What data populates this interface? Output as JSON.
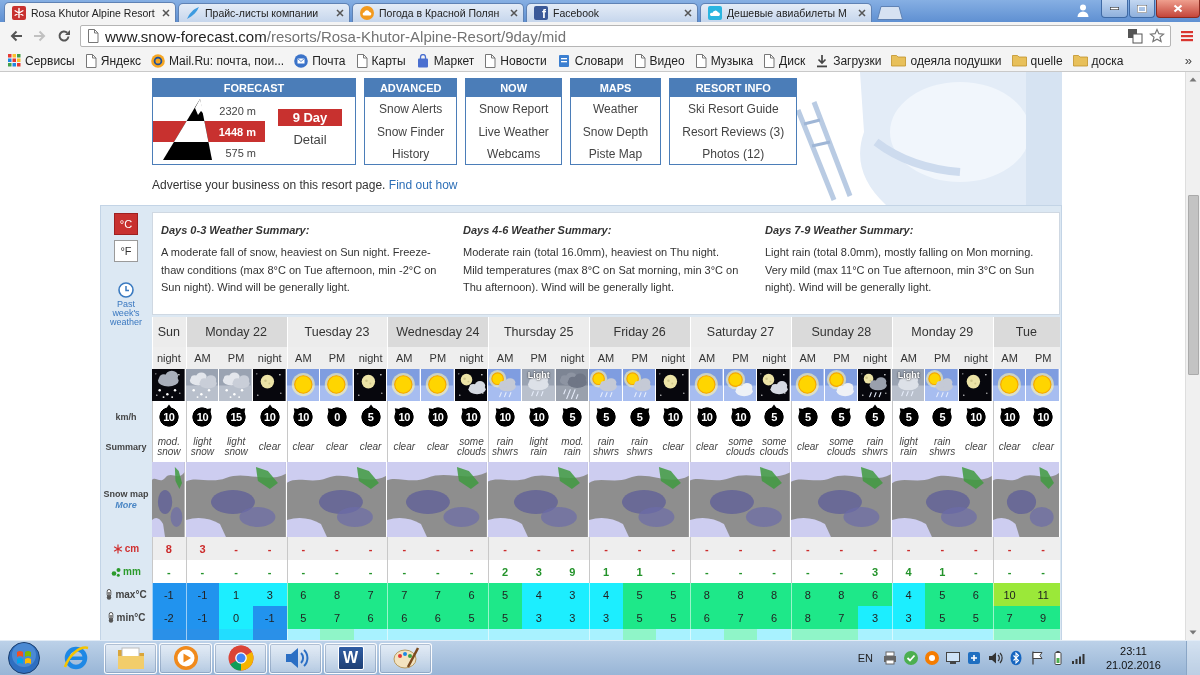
{
  "browser": {
    "tabs": [
      {
        "title": "Rosa Khutor Alpine Resort",
        "selected": true
      },
      {
        "title": "Прайс-листы компании",
        "selected": false
      },
      {
        "title": "Погода в Красной Полян",
        "selected": false
      },
      {
        "title": "Facebook",
        "icon_text": "f",
        "selected": false
      },
      {
        "title": "Дешевые авиабилеты М",
        "selected": false
      }
    ],
    "address": {
      "host": "www.snow-forecast.com",
      "path": "/resorts/Rosa-Khutor-Alpine-Resort/9day/mid"
    },
    "bookmarks": [
      {
        "label": "Сервисы"
      },
      {
        "label": "Яндекс"
      },
      {
        "label": "Mail.Ru: почта, пои..."
      },
      {
        "label": "Почта"
      },
      {
        "label": "Карты"
      },
      {
        "label": "Маркет"
      },
      {
        "label": "Новости"
      },
      {
        "label": "Словари"
      },
      {
        "label": "Видео"
      },
      {
        "label": "Музыка"
      },
      {
        "label": "Диск"
      },
      {
        "label": "Загрузки"
      },
      {
        "label": "одеяла подушки"
      },
      {
        "label": "quelle"
      },
      {
        "label": "доска"
      }
    ],
    "bookmarks_more": "»"
  },
  "site": {
    "nav": [
      {
        "kind": "forecast",
        "heading": "FORECAST",
        "elevations": [
          {
            "label": "2320 m",
            "selected": false
          },
          {
            "label": "1448 m",
            "selected": true
          },
          {
            "label": "575 m",
            "selected": false
          }
        ],
        "views": [
          {
            "label": "9 Day",
            "selected": true
          },
          {
            "label": "Detail",
            "selected": false
          }
        ]
      },
      {
        "kind": "links",
        "heading": "ADVANCED",
        "links": [
          "Snow Alerts",
          "Snow Finder",
          "History"
        ]
      },
      {
        "kind": "links",
        "heading": "NOW",
        "links": [
          "Snow Report",
          "Live Weather",
          "Webcams"
        ]
      },
      {
        "kind": "links",
        "heading": "MAPS",
        "links": [
          "Weather",
          "Snow Depth",
          "Piste Map"
        ]
      },
      {
        "kind": "links",
        "heading": "RESORT INFO",
        "links": [
          "Ski Resort Guide",
          "Resort Reviews (3)",
          "Photos (12)"
        ]
      }
    ],
    "advert": {
      "text": "Advertise your business on this resort page.",
      "link": "Find out how"
    }
  },
  "forecast": {
    "units": [
      {
        "label": "°C",
        "selected": true
      },
      {
        "label": "°F",
        "selected": false
      }
    ],
    "past_weather": "Past week's weather",
    "summaries": [
      {
        "title": "Days 0-3 Weather Summary:",
        "text": "A moderate fall of snow, heaviest on Sun night. Freeze-thaw conditions (max 8°C on Tue afternoon, min -2°C on Sun night). Wind will be generally light."
      },
      {
        "title": "Days 4-6 Weather Summary:",
        "text": "Moderate rain (total 16.0mm), heaviest on Thu night. Mild temperatures (max 8°C on Sat morning, min 3°C on Thu afternoon). Wind will be generally light."
      },
      {
        "title": "Days 7-9 Weather Summary:",
        "text": "Light rain (total 8.0mm), mostly falling on Mon morning. Very mild (max 11°C on Tue afternoon, min 3°C on Sun night). Wind will be generally light."
      }
    ],
    "row_labels": [
      {
        "kind": "wind",
        "label": "km/h"
      },
      {
        "kind": "summary",
        "label": "Summary"
      },
      {
        "kind": "map",
        "label": "Snow map",
        "link": "More"
      },
      {
        "kind": "snow",
        "label": "cm"
      },
      {
        "kind": "rain",
        "label": "mm"
      },
      {
        "kind": "max",
        "label": "max°C"
      },
      {
        "kind": "min",
        "label": "min°C"
      }
    ],
    "days": [
      {
        "name": "Sun",
        "periods": [
          {
            "time": "night",
            "icon": {
              "kind": "moonsnow"
            },
            "wind": {
              "speed": "10",
              "kind": "north"
            },
            "summary": "mod. snow",
            "snow": "8",
            "rain": "-",
            "max": "-1",
            "min": "-2"
          }
        ]
      },
      {
        "name": "Monday 22",
        "periods": [
          {
            "time": "AM",
            "icon": {
              "kind": "snow"
            },
            "wind": {
              "speed": "10",
              "kind": "northeast"
            },
            "summary": "light snow",
            "snow": "3",
            "rain": "-",
            "max": "-1",
            "min": "-1"
          },
          {
            "time": "PM",
            "icon": {
              "kind": "snow"
            },
            "wind": {
              "speed": "15",
              "kind": "northeast"
            },
            "summary": "light snow",
            "snow": "-",
            "rain": "-",
            "max": "1",
            "min": "0"
          },
          {
            "time": "night",
            "icon": {
              "kind": "moon"
            },
            "wind": {
              "speed": "10",
              "kind": "north"
            },
            "summary": "clear",
            "snow": "-",
            "rain": "-",
            "max": "3",
            "min": "-1"
          }
        ]
      },
      {
        "name": "Tuesday 23",
        "periods": [
          {
            "time": "AM",
            "icon": {
              "kind": "sun"
            },
            "wind": {
              "speed": "10",
              "kind": "northwest"
            },
            "summary": "clear",
            "snow": "-",
            "rain": "-",
            "max": "6",
            "min": "5"
          },
          {
            "time": "PM",
            "icon": {
              "kind": "sun"
            },
            "wind": {
              "speed": "0",
              "kind": "northwest"
            },
            "summary": "clear",
            "snow": "-",
            "rain": "-",
            "max": "8",
            "min": "7"
          },
          {
            "time": "night",
            "icon": {
              "kind": "moon"
            },
            "wind": {
              "speed": "5",
              "kind": "north"
            },
            "summary": "clear",
            "snow": "-",
            "rain": "-",
            "max": "7",
            "min": "6"
          }
        ]
      },
      {
        "name": "Wednesday 24",
        "periods": [
          {
            "time": "AM",
            "icon": {
              "kind": "sun"
            },
            "wind": {
              "speed": "10",
              "kind": "northwest"
            },
            "summary": "clear",
            "snow": "-",
            "rain": "-",
            "max": "7",
            "min": "6"
          },
          {
            "time": "PM",
            "icon": {
              "kind": "sun"
            },
            "wind": {
              "speed": "10",
              "kind": "northwest"
            },
            "summary": "clear",
            "snow": "-",
            "rain": "-",
            "max": "7",
            "min": "6"
          },
          {
            "time": "night",
            "icon": {
              "kind": "mooncloud"
            },
            "wind": {
              "speed": "10",
              "kind": "northwest"
            },
            "summary": "some clouds",
            "snow": "-",
            "rain": "-",
            "max": "6",
            "min": "5"
          }
        ]
      },
      {
        "name": "Thursday 25",
        "periods": [
          {
            "time": "AM",
            "icon": {
              "kind": "sunrain"
            },
            "wind": {
              "speed": "10",
              "kind": "northwest"
            },
            "summary": "rain shwrs",
            "snow": "-",
            "rain": "2",
            "max": "5",
            "min": "5"
          },
          {
            "time": "PM",
            "icon": {
              "kind": "rain",
              "caption": "Light"
            },
            "wind": {
              "speed": "10",
              "kind": "northwest"
            },
            "summary": "light rain",
            "snow": "-",
            "rain": "3",
            "max": "4",
            "min": "3"
          },
          {
            "time": "night",
            "icon": {
              "kind": "heavyrain"
            },
            "wind": {
              "speed": "5",
              "kind": "northwest"
            },
            "summary": "mod. rain",
            "snow": "-",
            "rain": "9",
            "max": "3",
            "min": "3"
          }
        ]
      },
      {
        "name": "Friday 26",
        "periods": [
          {
            "time": "AM",
            "icon": {
              "kind": "sunrain"
            },
            "wind": {
              "speed": "5",
              "kind": "northwest"
            },
            "summary": "rain shwrs",
            "snow": "-",
            "rain": "1",
            "max": "4",
            "min": "3"
          },
          {
            "time": "PM",
            "icon": {
              "kind": "sunrain"
            },
            "wind": {
              "speed": "5",
              "kind": "northeast"
            },
            "summary": "rain shwrs",
            "snow": "-",
            "rain": "1",
            "max": "5",
            "min": "5"
          },
          {
            "time": "night",
            "icon": {
              "kind": "moon"
            },
            "wind": {
              "speed": "10",
              "kind": "northwest"
            },
            "summary": "clear",
            "snow": "-",
            "rain": "-",
            "max": "5",
            "min": "5"
          }
        ]
      },
      {
        "name": "Saturday 27",
        "periods": [
          {
            "time": "AM",
            "icon": {
              "kind": "sun"
            },
            "wind": {
              "speed": "10",
              "kind": "northwest"
            },
            "summary": "clear",
            "snow": "-",
            "rain": "-",
            "max": "8",
            "min": "6"
          },
          {
            "time": "PM",
            "icon": {
              "kind": "suncloud"
            },
            "wind": {
              "speed": "10",
              "kind": "northwest"
            },
            "summary": "some clouds",
            "snow": "-",
            "rain": "-",
            "max": "8",
            "min": "7"
          },
          {
            "time": "night",
            "icon": {
              "kind": "mooncloud"
            },
            "wind": {
              "speed": "5",
              "kind": "north"
            },
            "summary": "some clouds",
            "snow": "-",
            "rain": "-",
            "max": "8",
            "min": "6"
          }
        ]
      },
      {
        "name": "Sunday 28",
        "periods": [
          {
            "time": "AM",
            "icon": {
              "kind": "sun"
            },
            "wind": {
              "speed": "5",
              "kind": "northwest"
            },
            "summary": "clear",
            "snow": "-",
            "rain": "-",
            "max": "8",
            "min": "8"
          },
          {
            "time": "PM",
            "icon": {
              "kind": "suncloud"
            },
            "wind": {
              "speed": "5",
              "kind": "northeast"
            },
            "summary": "some clouds",
            "snow": "-",
            "rain": "-",
            "max": "8",
            "min": "7"
          },
          {
            "time": "night",
            "icon": {
              "kind": "moonrain"
            },
            "wind": {
              "speed": "5",
              "kind": "north"
            },
            "summary": "rain shwrs",
            "snow": "-",
            "rain": "3",
            "max": "6",
            "min": "3"
          }
        ]
      },
      {
        "name": "Monday 29",
        "periods": [
          {
            "time": "AM",
            "icon": {
              "kind": "rain",
              "caption": "Light"
            },
            "wind": {
              "speed": "5",
              "kind": "northwest"
            },
            "summary": "light rain",
            "snow": "-",
            "rain": "4",
            "max": "4",
            "min": "3"
          },
          {
            "time": "PM",
            "icon": {
              "kind": "sunrain"
            },
            "wind": {
              "speed": "5",
              "kind": "northeast"
            },
            "summary": "rain shwrs",
            "snow": "-",
            "rain": "1",
            "max": "5",
            "min": "5"
          },
          {
            "time": "night",
            "icon": {
              "kind": "moon"
            },
            "wind": {
              "speed": "10",
              "kind": "northwest"
            },
            "summary": "clear",
            "snow": "-",
            "rain": "-",
            "max": "6",
            "min": "5"
          }
        ]
      },
      {
        "name": "Tue",
        "periods": [
          {
            "time": "AM",
            "icon": {
              "kind": "sun"
            },
            "wind": {
              "speed": "10",
              "kind": "northwest"
            },
            "summary": "clear",
            "snow": "-",
            "rain": "-",
            "max": "10",
            "min": "7"
          },
          {
            "time": "PM",
            "icon": {
              "kind": "sun"
            },
            "wind": {
              "speed": "10",
              "kind": "northwest"
            },
            "summary": "clear",
            "snow": "-",
            "rain": "-",
            "max": "11",
            "min": "9"
          }
        ]
      }
    ],
    "partial_row": {
      "cells": [
        {
          "color": "#2a90e8"
        },
        {
          "color": "#2a90e8"
        },
        {
          "color": "#22ddff"
        },
        {
          "color": "#2a90e8"
        },
        {
          "color": "#a8f2ff"
        },
        {
          "color": "#8ff5c8"
        },
        {
          "color": "#a8f2ff"
        },
        {
          "color": "#a8f2ff"
        },
        {
          "color": "#a8f2ff"
        },
        {
          "color": "#a8f2ff"
        },
        {
          "color": "#a8f2ff"
        },
        {
          "color": "#a8f2ff"
        },
        {
          "color": "#a8f2ff"
        },
        {
          "color": "#a8f2ff"
        },
        {
          "color": "#8ff5c8"
        },
        {
          "color": "#a8f2ff"
        },
        {
          "color": "#a8f2ff"
        },
        {
          "color": "#8ff5c8"
        },
        {
          "color": "#a8f2ff"
        },
        {
          "color": "#8ff5c8"
        },
        {
          "color": "#8ff5c8"
        },
        {
          "color": "#a8f2ff"
        },
        {
          "color": "#a8f2ff"
        },
        {
          "color": "#a8f2ff"
        },
        {
          "color": "#a8f2ff"
        },
        {
          "color": "#8ff5c8"
        },
        {
          "color": "#8ff5c8"
        }
      ]
    }
  },
  "taskbar": {
    "apps": [
      {
        "kind": "ie",
        "active": false
      },
      {
        "kind": "folder",
        "active": true
      },
      {
        "kind": "media",
        "active": true
      },
      {
        "kind": "chrome",
        "active": true
      },
      {
        "kind": "speaker",
        "active": true
      },
      {
        "kind": "word",
        "letter": "W",
        "active": true
      },
      {
        "kind": "paint",
        "active": true
      }
    ],
    "language": "EN",
    "time": "23:11",
    "date": "21.02.2016"
  }
}
